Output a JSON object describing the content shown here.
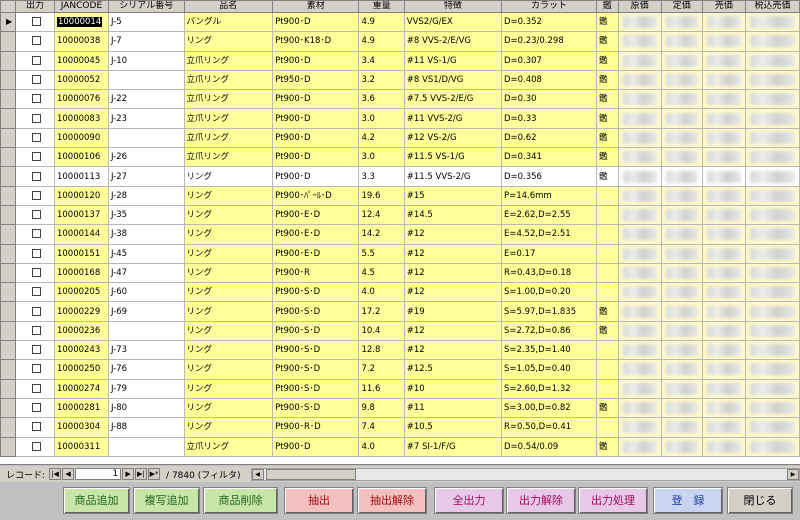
{
  "columns": [
    "",
    "出力",
    "JANCODE",
    "シリアル番号",
    "品名",
    "素材",
    "重量",
    "特徴",
    "カラット",
    "鑑",
    "原価",
    "定価",
    "売価",
    "税込売価"
  ],
  "rows": [
    {
      "jan": "10000014",
      "serial": "J-5",
      "name": "バングル",
      "material": "Pt900･D",
      "weight": "4.9",
      "feature": "VVS2/G/EX",
      "carat": "D=0.352",
      "kan": "鑑",
      "current": true
    },
    {
      "jan": "10000038",
      "serial": "J-7",
      "name": "リング",
      "material": "Pt900･K18･D",
      "weight": "4.9",
      "feature": "#8 VVS-2/E/VG",
      "carat": "D=0.23/0.298",
      "kan": "鑑"
    },
    {
      "jan": "10000045",
      "serial": "J-10",
      "name": "立爪リング",
      "material": "Pt900･D",
      "weight": "3.4",
      "feature": "#11 VS-1/G",
      "carat": "D=0.307",
      "kan": "鑑"
    },
    {
      "jan": "10000052",
      "serial": "",
      "name": "立爪リング",
      "material": "Pt950･D",
      "weight": "3.2",
      "feature": "#8 VS1/D/VG",
      "carat": "D=0.408",
      "kan": "鑑"
    },
    {
      "jan": "10000076",
      "serial": "J-22",
      "name": "立爪リング",
      "material": "Pt900･D",
      "weight": "3.6",
      "feature": "#7.5 VVS-2/E/G",
      "carat": "D=0.30",
      "kan": "鑑"
    },
    {
      "jan": "10000083",
      "serial": "J-23",
      "name": "立爪リング",
      "material": "Pt900･D",
      "weight": "3.0",
      "feature": "#11 VVS-2/G",
      "carat": "D=0.33",
      "kan": "鑑"
    },
    {
      "jan": "10000090",
      "serial": "",
      "name": "立爪リング",
      "material": "Pt900･D",
      "weight": "4.2",
      "feature": "#12 VS-2/G",
      "carat": "D=0.62",
      "kan": "鑑"
    },
    {
      "jan": "10000106",
      "serial": "J-26",
      "name": "立爪リング",
      "material": "Pt900･D",
      "weight": "3.0",
      "feature": "#11.5 VS-1/G",
      "carat": "D=0.341",
      "kan": "鑑"
    },
    {
      "jan": "10000113",
      "serial": "J-27",
      "name": "リング",
      "material": "Pt900･D",
      "weight": "3.3",
      "feature": "#11.5 VVS-2/G",
      "carat": "D=0.356",
      "kan": "鑑",
      "white": true
    },
    {
      "jan": "10000120",
      "serial": "J-28",
      "name": "リング",
      "material": "Pt900･ﾊﾟｰﾙ･D",
      "weight": "19.6",
      "feature": "#15",
      "carat": "P=14.6mm",
      "kan": ""
    },
    {
      "jan": "10000137",
      "serial": "J-35",
      "name": "リング",
      "material": "Pt900･E･D",
      "weight": "12.4",
      "feature": "#14.5",
      "carat": "E=2.62,D=2.55",
      "kan": ""
    },
    {
      "jan": "10000144",
      "serial": "J-38",
      "name": "リング",
      "material": "Pt900･E･D",
      "weight": "14.2",
      "feature": "#12",
      "carat": "E=4.52,D=2.51",
      "kan": ""
    },
    {
      "jan": "10000151",
      "serial": "J-45",
      "name": "リング",
      "material": "Pt900･E･D",
      "weight": "5.5",
      "feature": "#12",
      "carat": "E=0.17",
      "kan": ""
    },
    {
      "jan": "10000168",
      "serial": "J-47",
      "name": "リング",
      "material": "Pt900･R",
      "weight": "4.5",
      "feature": "#12",
      "carat": "R=0.43,D=0.18",
      "kan": ""
    },
    {
      "jan": "10000205",
      "serial": "J-60",
      "name": "リング",
      "material": "Pt900･S･D",
      "weight": "4.0",
      "feature": "#12",
      "carat": "S=1.00,D=0.20",
      "kan": ""
    },
    {
      "jan": "10000229",
      "serial": "J-69",
      "name": "リング",
      "material": "Pt900･S･D",
      "weight": "17.2",
      "feature": "#19",
      "carat": "S=5.97,D=1.835",
      "kan": "鑑"
    },
    {
      "jan": "10000236",
      "serial": "",
      "name": "リング",
      "material": "Pt900･S･D",
      "weight": "10.4",
      "feature": "#12",
      "carat": "S=2.72,D=0.86",
      "kan": "鑑"
    },
    {
      "jan": "10000243",
      "serial": "J-73",
      "name": "リング",
      "material": "Pt900･S･D",
      "weight": "12.8",
      "feature": "#12",
      "carat": "S=2.35,D=1.40",
      "kan": ""
    },
    {
      "jan": "10000250",
      "serial": "J-76",
      "name": "リング",
      "material": "Pt900･S･D",
      "weight": "7.2",
      "feature": "#12.5",
      "carat": "S=1.05,D=0.40",
      "kan": ""
    },
    {
      "jan": "10000274",
      "serial": "J-79",
      "name": "リング",
      "material": "Pt900･S･D",
      "weight": "11.6",
      "feature": "#10",
      "carat": "S=2.60,D=1.32",
      "kan": ""
    },
    {
      "jan": "10000281",
      "serial": "J-80",
      "name": "リング",
      "material": "Pt900･S･D",
      "weight": "9.8",
      "feature": "#11",
      "carat": "S=3.00,D=0.82",
      "kan": "鑑"
    },
    {
      "jan": "10000304",
      "serial": "J-88",
      "name": "リング",
      "material": "Pt900･R･D",
      "weight": "7.4",
      "feature": "#10.5",
      "carat": "R=0.50,D=0.41",
      "kan": ""
    },
    {
      "jan": "10000311",
      "serial": "",
      "name": "立爪リング",
      "material": "Pt900･D",
      "weight": "4.0",
      "feature": "#7 SI-1/F/G",
      "carat": "D=0.54/0.09",
      "kan": "鑑"
    }
  ],
  "nav": {
    "label": "レコード:",
    "current": "1",
    "total": "/ 7840 (フィルタ)",
    "first": "|◀",
    "prev": "◀",
    "next": "▶",
    "last": "▶|",
    "new": "▶*"
  },
  "buttons": {
    "add": "商品追加",
    "copy_add": "複写追加",
    "delete": "商品削除",
    "extract": "抽出",
    "extract_clear": "抽出解除",
    "all_output": "全出力",
    "output_clear": "出力解除",
    "output_process": "出力処理",
    "register": "登　録",
    "close": "閉じる"
  },
  "colors": {
    "highlight": "#ffff99",
    "green_btn": "#c8e6a8",
    "red_btn": "#f4c0c0",
    "purple_btn": "#e8c8e8",
    "blue_btn": "#c8d4f0"
  }
}
